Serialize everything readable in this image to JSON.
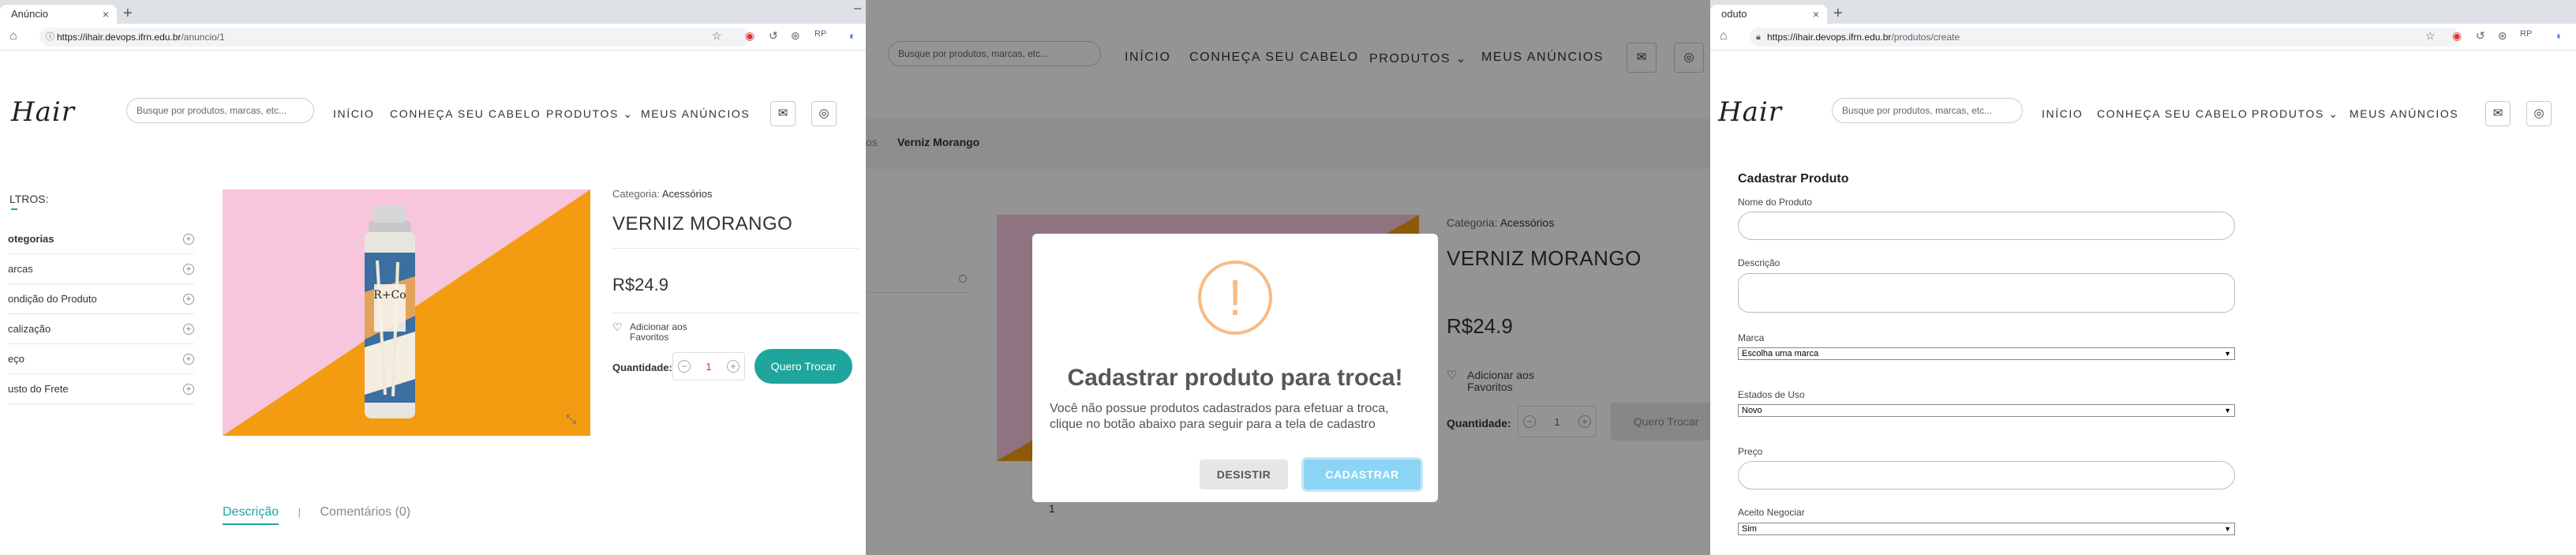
{
  "panel1": {
    "tab_title": "Anúncio",
    "tab_close": "×",
    "new_tab": "+",
    "minimize": "–",
    "url_host": "https://ihair.devops.ifrn.edu.br",
    "url_path": "/anuncio/1",
    "logo": "Hair",
    "search_placeholder": "Busque por produtos, marcas, etc...",
    "menu": [
      "INÍCIO",
      "CONHEÇA SEU CABELO",
      "PRODUTOS ⌄",
      "MEUS ANÚNCIOS"
    ],
    "filters_title": "LTROS:",
    "filters": [
      "otegorias",
      "arcas",
      "ondição do Produto",
      "calização",
      "eço",
      "usto do Frete"
    ],
    "category_label": "Categoria:",
    "category_value": "Acessórios",
    "product_name": "VERNIZ MORANGO",
    "price": "R$24.9",
    "wishlist": "Adicionar aos Favoritos",
    "qty_label": "Quantidade:",
    "qty_value": "1",
    "trade_button": "Quero Trocar",
    "tab_description": "Descrição",
    "tab_separator": "|",
    "tab_comments": "Comentários (0)",
    "product_image_brand": "R+Co"
  },
  "panel2": {
    "search_placeholder": "Busque por produtos, marcas, etc...",
    "menu": [
      "INÍCIO",
      "CONHEÇA SEU CABELO",
      "PRODUTOS ⌄",
      "MEUS ANÚNCIOS"
    ],
    "breadcrumb_prev": "os",
    "breadcrumb_current": "Verniz Morango",
    "category_label": "Categoria:",
    "category_value": "Acessórios",
    "product_name": "VERNIZ MORANGO",
    "price": "R$24.9",
    "wishlist": "Adicionar aos Favoritos",
    "qty_label": "Quantidade:",
    "qty_value": "1",
    "trade_button": "Quero Trocar",
    "page_number": "1",
    "modal": {
      "icon": "!",
      "title": "Cadastrar produto para troca!",
      "text": "Você não possue produtos cadastrados para efetuar a troca, clique no botão abaixo para seguir para a tela de cadastro",
      "cancel": "DESISTIR",
      "confirm": "CADASTRAR"
    }
  },
  "panel3": {
    "tab_title": "oduto",
    "tab_close": "×",
    "new_tab": "+",
    "url_host": "https://ihair.devops.ifrn.edu.br",
    "url_path": "/produtos/create",
    "logo": "Hair",
    "search_placeholder": "Busque por produtos, marcas, etc...",
    "menu": [
      "INÍCIO",
      "CONHEÇA SEU CABELO",
      "PRODUTOS ⌄",
      "MEUS ANÚNCIOS"
    ],
    "form_title": "Cadastrar Produto",
    "label_name": "Nome do Produto",
    "label_description": "Descrição",
    "label_brand": "Marca",
    "brand_value": "Escolha uma marca",
    "label_state": "Estados de Uso",
    "state_value": "Novo",
    "label_price": "Preço",
    "label_negotiate": "Aceito Negociar",
    "negotiate_value": "Sim"
  },
  "colors": {
    "teal": "#1fa59b",
    "modal_confirm": "#8cd4f5",
    "pink": "#f7c6dd",
    "orange": "#f39c12"
  }
}
